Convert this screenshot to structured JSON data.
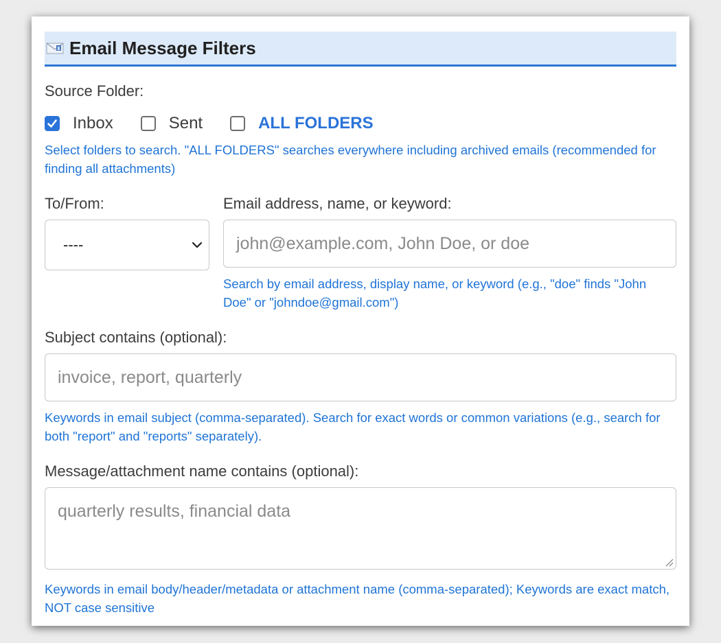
{
  "header": {
    "title": "Email Message Filters",
    "icon": "email-icon"
  },
  "source_folder": {
    "label": "Source Folder:",
    "options": [
      {
        "label": "Inbox",
        "checked": true
      },
      {
        "label": "Sent",
        "checked": false
      },
      {
        "label": "ALL FOLDERS",
        "checked": false
      }
    ],
    "hint": "Select folders to search. \"ALL FOLDERS\" searches everywhere including archived emails (recommended for finding all attachments)"
  },
  "to_from": {
    "label": "To/From:",
    "selected": "----",
    "icon": "chevron-down-icon"
  },
  "address": {
    "label": "Email address, name, or keyword:",
    "value": "",
    "placeholder": "john@example.com, John Doe, or doe",
    "hint": "Search by email address, display name, or keyword (e.g., \"doe\" finds \"John Doe\" or \"johndoe@gmail.com\")"
  },
  "subject": {
    "label": "Subject contains (optional):",
    "value": "",
    "placeholder": "invoice, report, quarterly",
    "hint": "Keywords in email subject (comma-separated). Search for exact words or common variations (e.g., search for both \"report\" and \"reports\" separately)."
  },
  "attachment": {
    "label": "Message/attachment name contains (optional):",
    "value": "",
    "placeholder": "quarterly results, financial data",
    "hint": "Keywords in email body/header/metadata or attachment name (comma-separated); Keywords are exact match, NOT case sensitive"
  },
  "colors": {
    "accent": "#2a73d9",
    "hint": "#1f74d6",
    "header_bg": "#ddeaf9"
  }
}
